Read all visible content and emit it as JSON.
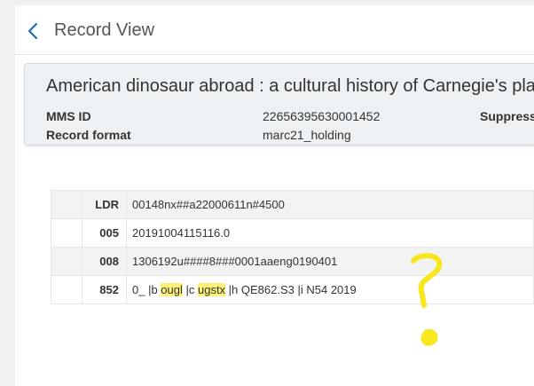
{
  "header": {
    "title": "Record View"
  },
  "record": {
    "title": "American dinosaur abroad : a cultural history of Carnegie's plas",
    "fields": {
      "mms_id_label": "MMS ID",
      "mms_id_value": "22656395630001452",
      "format_label": "Record format",
      "format_value": "marc21_holding",
      "suppress_label": "Suppress"
    }
  },
  "marc": {
    "rows": [
      {
        "tag": "LDR",
        "content": "00148nx##a22000611n#4500"
      },
      {
        "tag": "005",
        "content": "20191004115116.0"
      },
      {
        "tag": "008",
        "content": "1306192u####8###0001aaeng0190401"
      },
      {
        "tag": "852",
        "parts": {
          "p1": "0_ |b ",
          "hl1": "ougl",
          "p2": " |c ",
          "hl2": "ugstx",
          "p3": " |h QE862.S3 |i N54 2019"
        }
      }
    ]
  },
  "colors": {
    "accent": "#1c6fb8",
    "highlight": "#fff176",
    "annotation": "#f8e71c"
  },
  "icons": {
    "back": "chevron-left-icon"
  }
}
